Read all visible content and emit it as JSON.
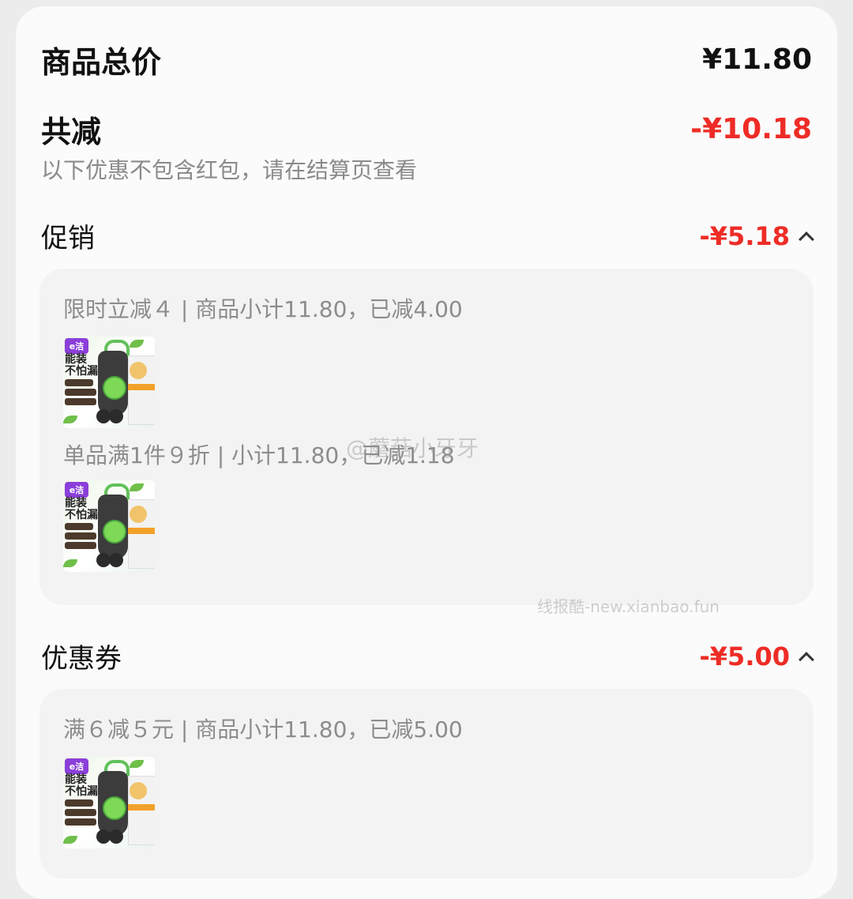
{
  "summary": {
    "total_label": "商品总价",
    "total_value": "¥11.80",
    "discount_label": "共减",
    "discount_value": "-¥10.18",
    "note": "以下优惠不包含红包，请在结算页查看"
  },
  "promotion": {
    "label": "促销",
    "amount": "-¥5.18",
    "items": [
      {
        "text": "限时立减４ | 商品小计11.80，已减4.00"
      },
      {
        "text": "单品满1件９折 | 小计11.80，已减1.18"
      }
    ]
  },
  "coupon": {
    "label": "优惠券",
    "amount": "-¥5.00",
    "items": [
      {
        "text": "满６减５元 | 商品小计11.80，已减5.00"
      }
    ]
  },
  "thumb": {
    "brand": "e洁",
    "headline": "能装\n不怕漏"
  },
  "watermarks": {
    "weibo": "@蘑菇小牙牙",
    "site": "线报酷-new.xianbao.fun"
  },
  "colors": {
    "discount_red": "#ee2c26"
  },
  "icons": {
    "expand": "chevron-up-icon"
  }
}
